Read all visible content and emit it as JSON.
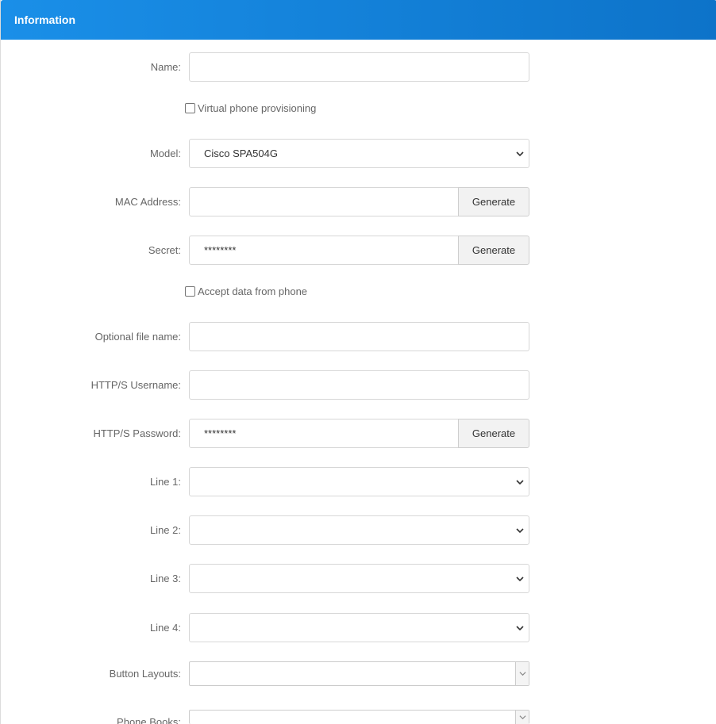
{
  "header": {
    "title": "Information"
  },
  "form": {
    "name": {
      "label": "Name:",
      "value": ""
    },
    "virtual_provisioning": {
      "label": "Virtual phone provisioning",
      "checked": false
    },
    "model": {
      "label": "Model:",
      "value": "Cisco SPA504G"
    },
    "mac": {
      "label": "MAC Address:",
      "value": "",
      "button": "Generate"
    },
    "secret": {
      "label": "Secret:",
      "value": "********",
      "button": "Generate"
    },
    "accept_data": {
      "label": "Accept data from phone",
      "checked": false
    },
    "optional_file": {
      "label": "Optional file name:",
      "value": ""
    },
    "http_user": {
      "label": "HTTP/S Username:",
      "value": ""
    },
    "http_pass": {
      "label": "HTTP/S Password:",
      "value": "********",
      "button": "Generate"
    },
    "line1": {
      "label": "Line 1:",
      "value": ""
    },
    "line2": {
      "label": "Line 2:",
      "value": ""
    },
    "line3": {
      "label": "Line 3:",
      "value": ""
    },
    "line4": {
      "label": "Line 4:",
      "value": ""
    },
    "button_layouts": {
      "label": "Button Layouts:",
      "value": ""
    },
    "phone_books": {
      "label": "Phone Books:",
      "value": ""
    }
  },
  "colors": {
    "header_start": "#1a8fe8",
    "header_end": "#0d73c9"
  },
  "icons": {
    "select_arrow": "chevron-down-icon"
  }
}
